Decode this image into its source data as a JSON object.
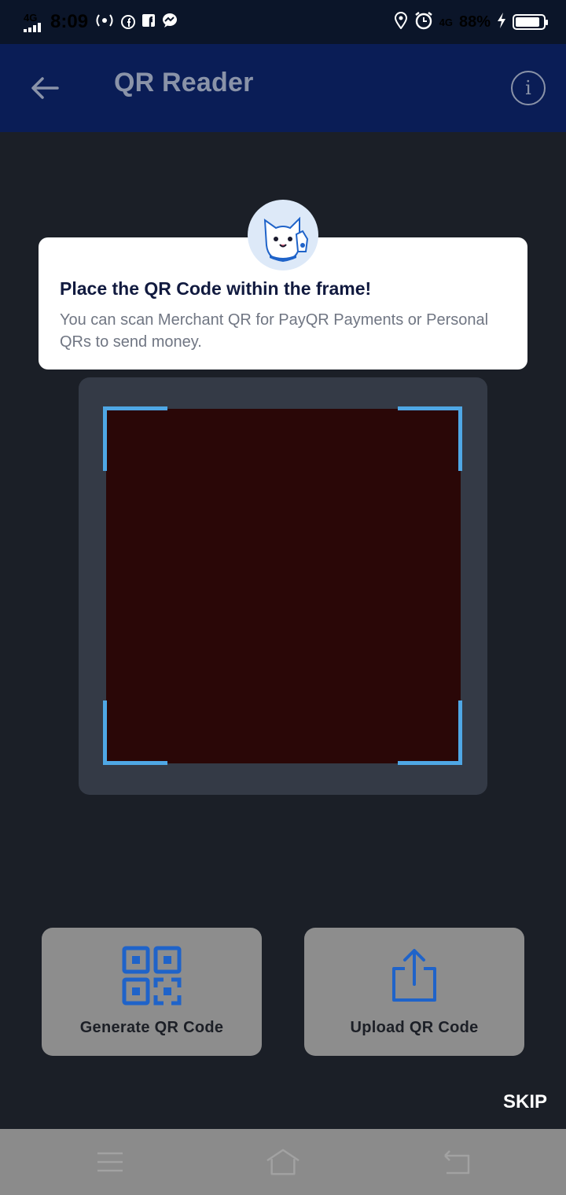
{
  "status_bar": {
    "network_left": "4G",
    "time": "8:09",
    "network_right": "4G",
    "battery_percent": "88%",
    "battery_level": 0.88,
    "icons": [
      "signal-icon",
      "hotspot-icon",
      "facebook-icon",
      "facebook-square-icon",
      "messenger-icon",
      "location-icon",
      "alarm-icon",
      "charging-icon",
      "battery-icon"
    ]
  },
  "app_bar": {
    "title": "QR Reader",
    "back_icon": "arrow-left-icon",
    "info_symbol": "i"
  },
  "tip": {
    "title": "Place the QR Code within the frame!",
    "body": "You can scan Merchant QR for PayQR Payments or Personal QRs to send money."
  },
  "actions": {
    "generate_label": "Generate QR Code",
    "upload_label": "Upload QR Code"
  },
  "skip_label": "SKIP",
  "colors": {
    "app_bar": "#0a1d56",
    "accent_blue": "#1f63c9",
    "frame_corner": "#4fa7e5",
    "title_text": "#111a3f"
  }
}
